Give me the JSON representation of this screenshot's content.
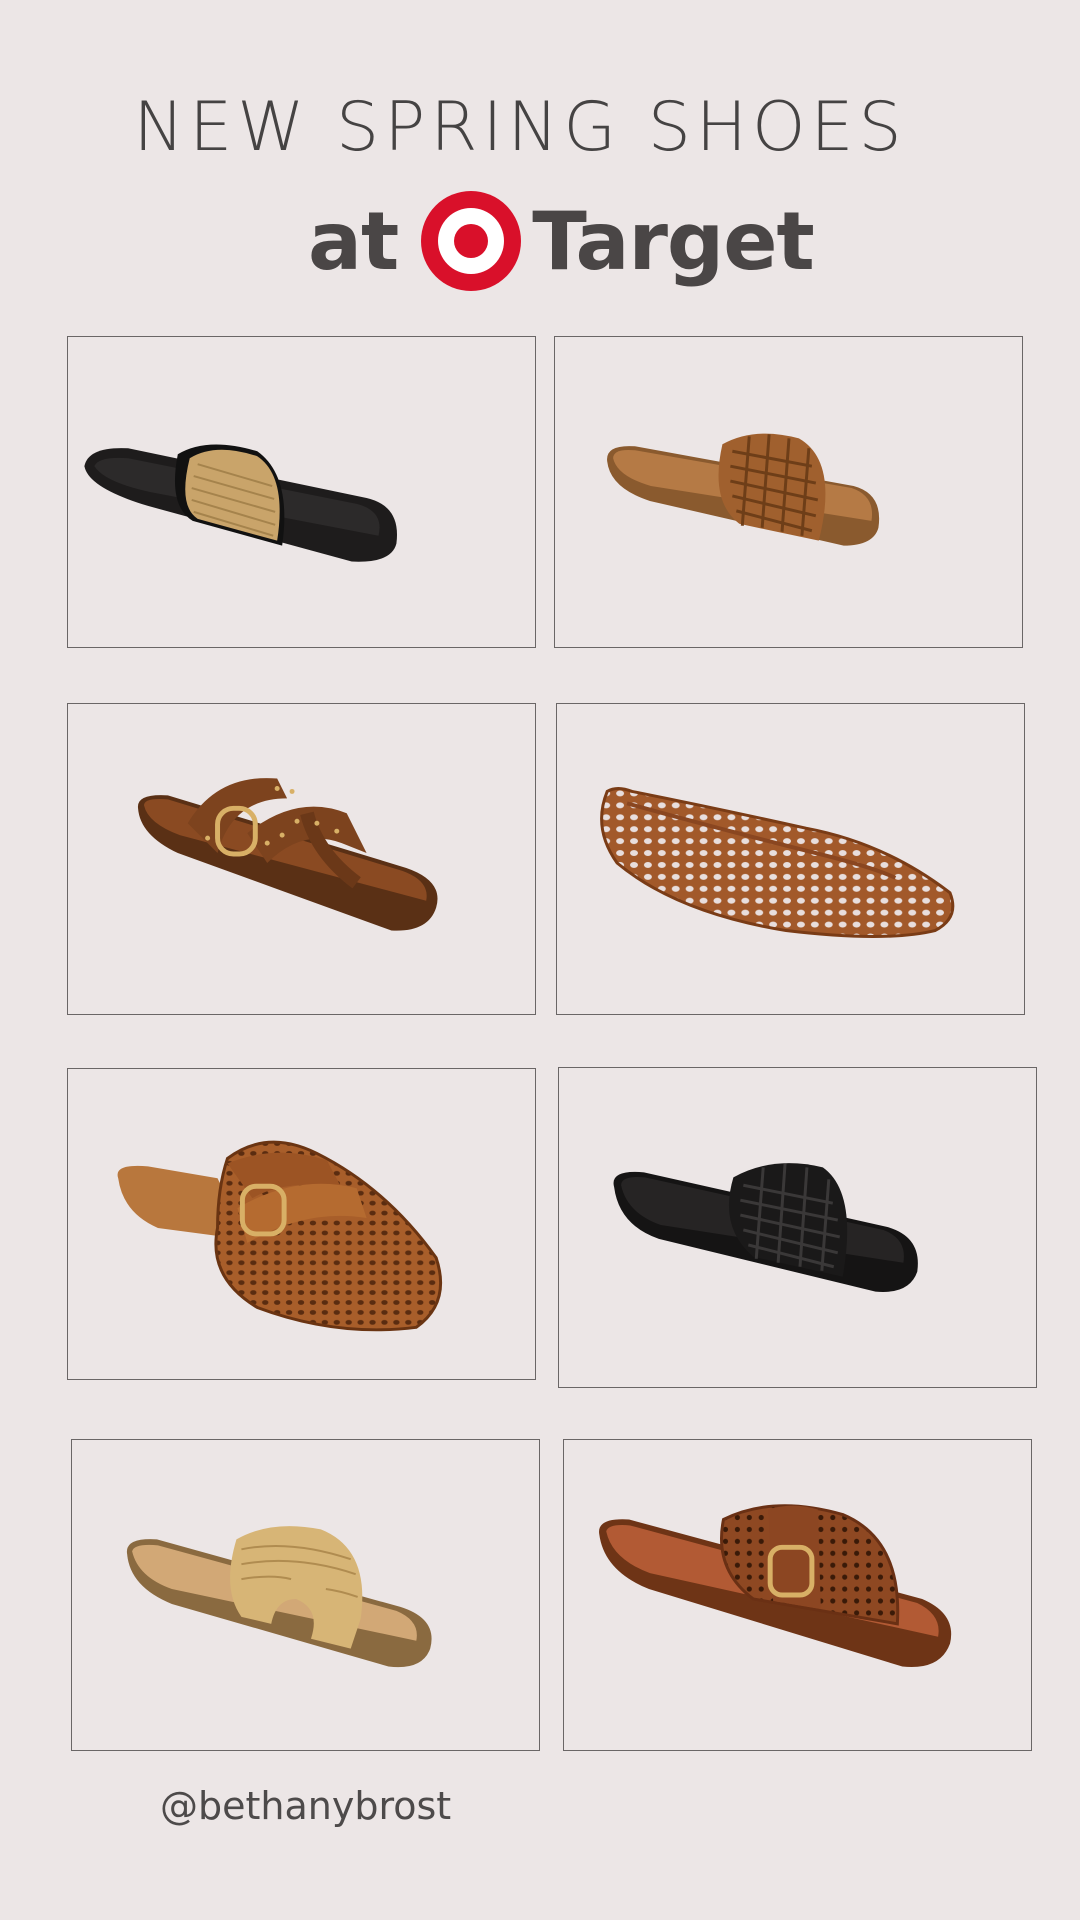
{
  "header": {
    "headline": "NEW SPRING SHOES",
    "brand_prefix": "at",
    "brand_logo_icon": "target-bullseye-icon",
    "brand_name": "Target"
  },
  "colors": {
    "background": "#ece6e6",
    "text": "#4a4646",
    "target_red": "#d9102a"
  },
  "products": [
    {
      "image": "black-slide-sandal-with-woven-straw-strap"
    },
    {
      "image": "cognac-woven-leather-slide-sandal"
    },
    {
      "image": "brown-studded-buckle-toe-ring-sandal"
    },
    {
      "image": "cognac-woven-ballet-flat"
    },
    {
      "image": "cognac-woven-buckle-mule"
    },
    {
      "image": "black-woven-leather-slide-sandal"
    },
    {
      "image": "natural-raffia-cutout-slide-sandal"
    },
    {
      "image": "cognac-perforated-buckle-slide-sandal"
    }
  ],
  "footer": {
    "handle": "@bethanybrost"
  }
}
